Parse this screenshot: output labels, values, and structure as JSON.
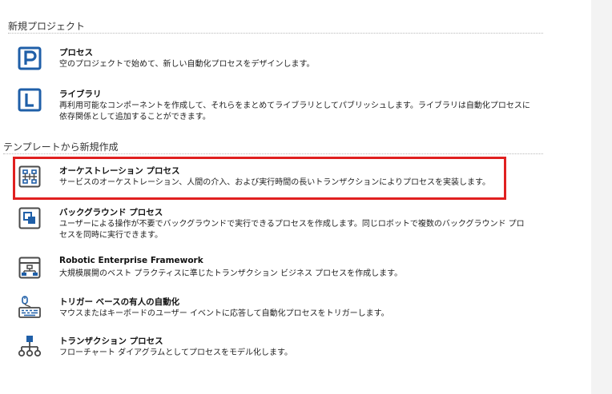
{
  "sections": {
    "new_project": {
      "title": "新規プロジェクト"
    },
    "from_template": {
      "title": "テンプレートから新規作成"
    }
  },
  "items": {
    "process": {
      "title": "プロセス",
      "desc": "空のプロジェクトで始めて、新しい自動化プロセスをデザインします。",
      "icon": "process-p-icon"
    },
    "library": {
      "title": "ライブラリ",
      "desc": "再利用可能なコンポーネントを作成して、それらをまとめてライブラリとしてパブリッシュします。ライブラリは自動化プロセスに依存関係として追加することができます。",
      "icon": "library-l-icon"
    },
    "orchestration": {
      "title": "オーケストレーション プロセス",
      "desc": "サービスのオーケストレーション、人間の介入、および実行時間の長いトランザクションによりプロセスを実装します。",
      "icon": "orchestration-icon"
    },
    "background": {
      "title": "バックグラウンド プロセス",
      "desc": "ユーザーによる操作が不要でバックグラウンドで実行できるプロセスを作成します。同じロボットで複数のバックグラウンド プロセスを同時に実行できます。",
      "icon": "background-process-icon"
    },
    "ref": {
      "title": "Robotic Enterprise Framework",
      "desc": "大規模展開のベスト プラクティスに準じたトランザクション ビジネス プロセスを作成します。",
      "icon": "framework-icon"
    },
    "trigger": {
      "title": "トリガー ベースの有人の自動化",
      "desc": "マウスまたはキーボードのユーザー イベントに応答して自動化プロセスをトリガーします。",
      "icon": "trigger-mouse-keyboard-icon"
    },
    "transaction": {
      "title": "トランザクション プロセス",
      "desc": "フローチャート ダイアグラムとしてプロセスをモデル化します。",
      "icon": "flowchart-icon"
    }
  },
  "colors": {
    "icon_blue": "#1f5fa8",
    "icon_gray": "#4a4a4a",
    "highlight": "#e02020"
  }
}
